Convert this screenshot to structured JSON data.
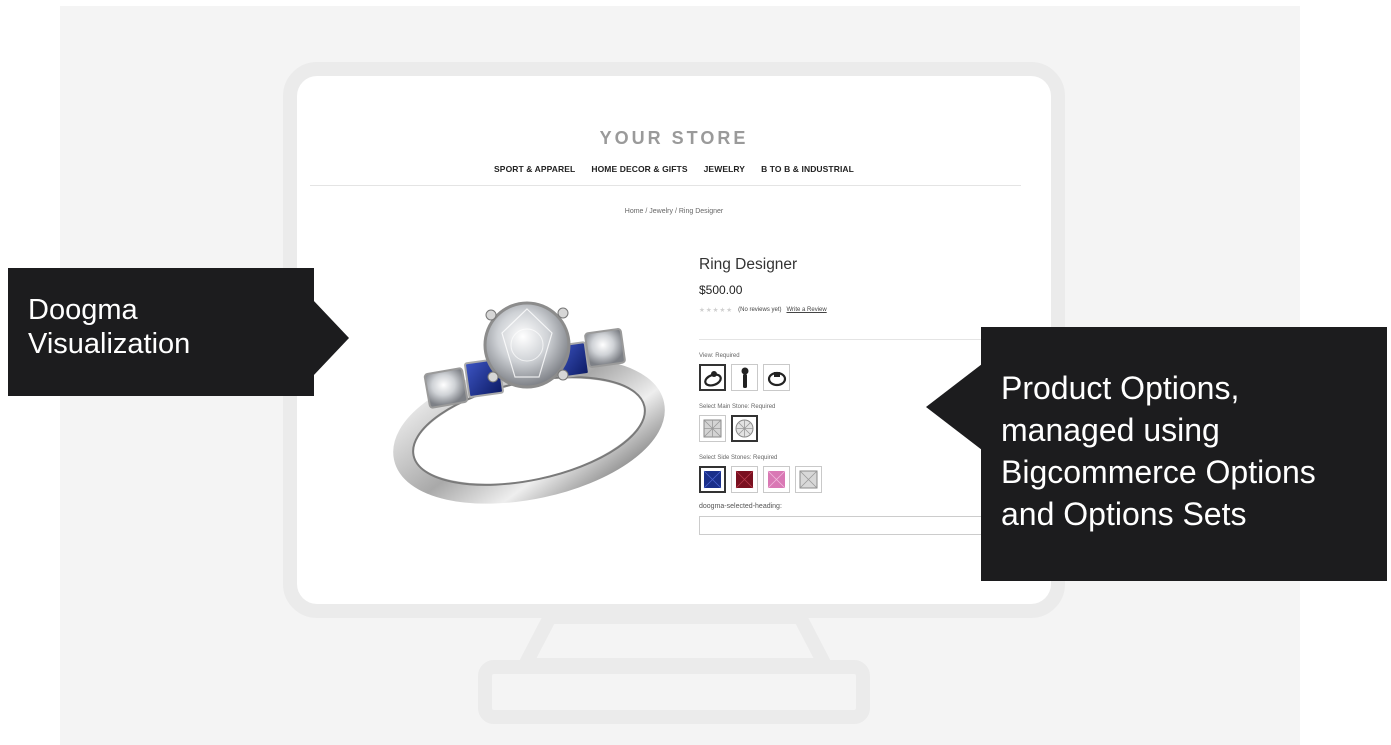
{
  "store": {
    "title": "YOUR STORE",
    "nav": [
      "SPORT & APPAREL",
      "HOME DECOR & GIFTS",
      "JEWELRY",
      "B TO B & INDUSTRIAL"
    ],
    "breadcrumb": "Home  /  Jewelry  /  Ring Designer"
  },
  "product": {
    "title": "Ring Designer",
    "price": "$500.00",
    "stars": "★★★★★",
    "reviews": "(No reviews yet)",
    "write_review": "Write a Review",
    "options": [
      {
        "label": "View:  Required",
        "swatches": [
          "ring-angle-icon",
          "ring-side-icon",
          "ring-top-icon"
        ],
        "selected": 0
      },
      {
        "label": "Select Main Stone:  Required",
        "swatches": [
          "princess-diamond",
          "round-diamond"
        ],
        "selected": 1
      },
      {
        "label": "Select Side Stones:  Required",
        "swatches": [
          "sapphire",
          "ruby",
          "pink-sapphire",
          "diamond"
        ],
        "selected": 0
      }
    ],
    "selected_heading": "doogma-selected-heading:"
  },
  "callouts": {
    "left": [
      "Doogma",
      "Visualization"
    ],
    "right": [
      "Product Options,",
      "managed using",
      "Bigcommerce Options",
      "and Options Sets"
    ]
  },
  "colors": {
    "callout_bg": "#1c1c1e",
    "sapphire": "#1a2f8a",
    "ruby": "#7a1020",
    "pink_sapphire": "#d978b4",
    "diamond": "#d8d8d8"
  }
}
